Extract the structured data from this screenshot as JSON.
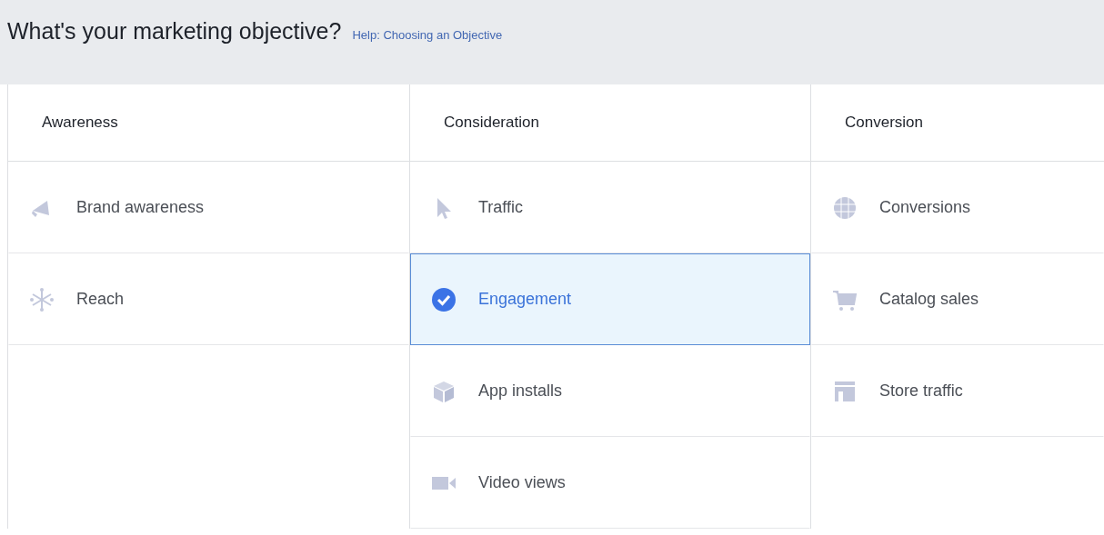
{
  "header": {
    "title": "What's your marketing objective?",
    "help_link": "Help: Choosing an Objective"
  },
  "columns": [
    {
      "heading": "Awareness",
      "items": [
        {
          "label": "Brand awareness",
          "selected": false
        },
        {
          "label": "Reach",
          "selected": false
        }
      ]
    },
    {
      "heading": "Consideration",
      "items": [
        {
          "label": "Traffic",
          "selected": false
        },
        {
          "label": "Engagement",
          "selected": true
        },
        {
          "label": "App installs",
          "selected": false
        },
        {
          "label": "Video views",
          "selected": false
        }
      ]
    },
    {
      "heading": "Conversion",
      "items": [
        {
          "label": "Conversions",
          "selected": false
        },
        {
          "label": "Catalog sales",
          "selected": false
        },
        {
          "label": "Store traffic",
          "selected": false
        }
      ]
    }
  ]
}
